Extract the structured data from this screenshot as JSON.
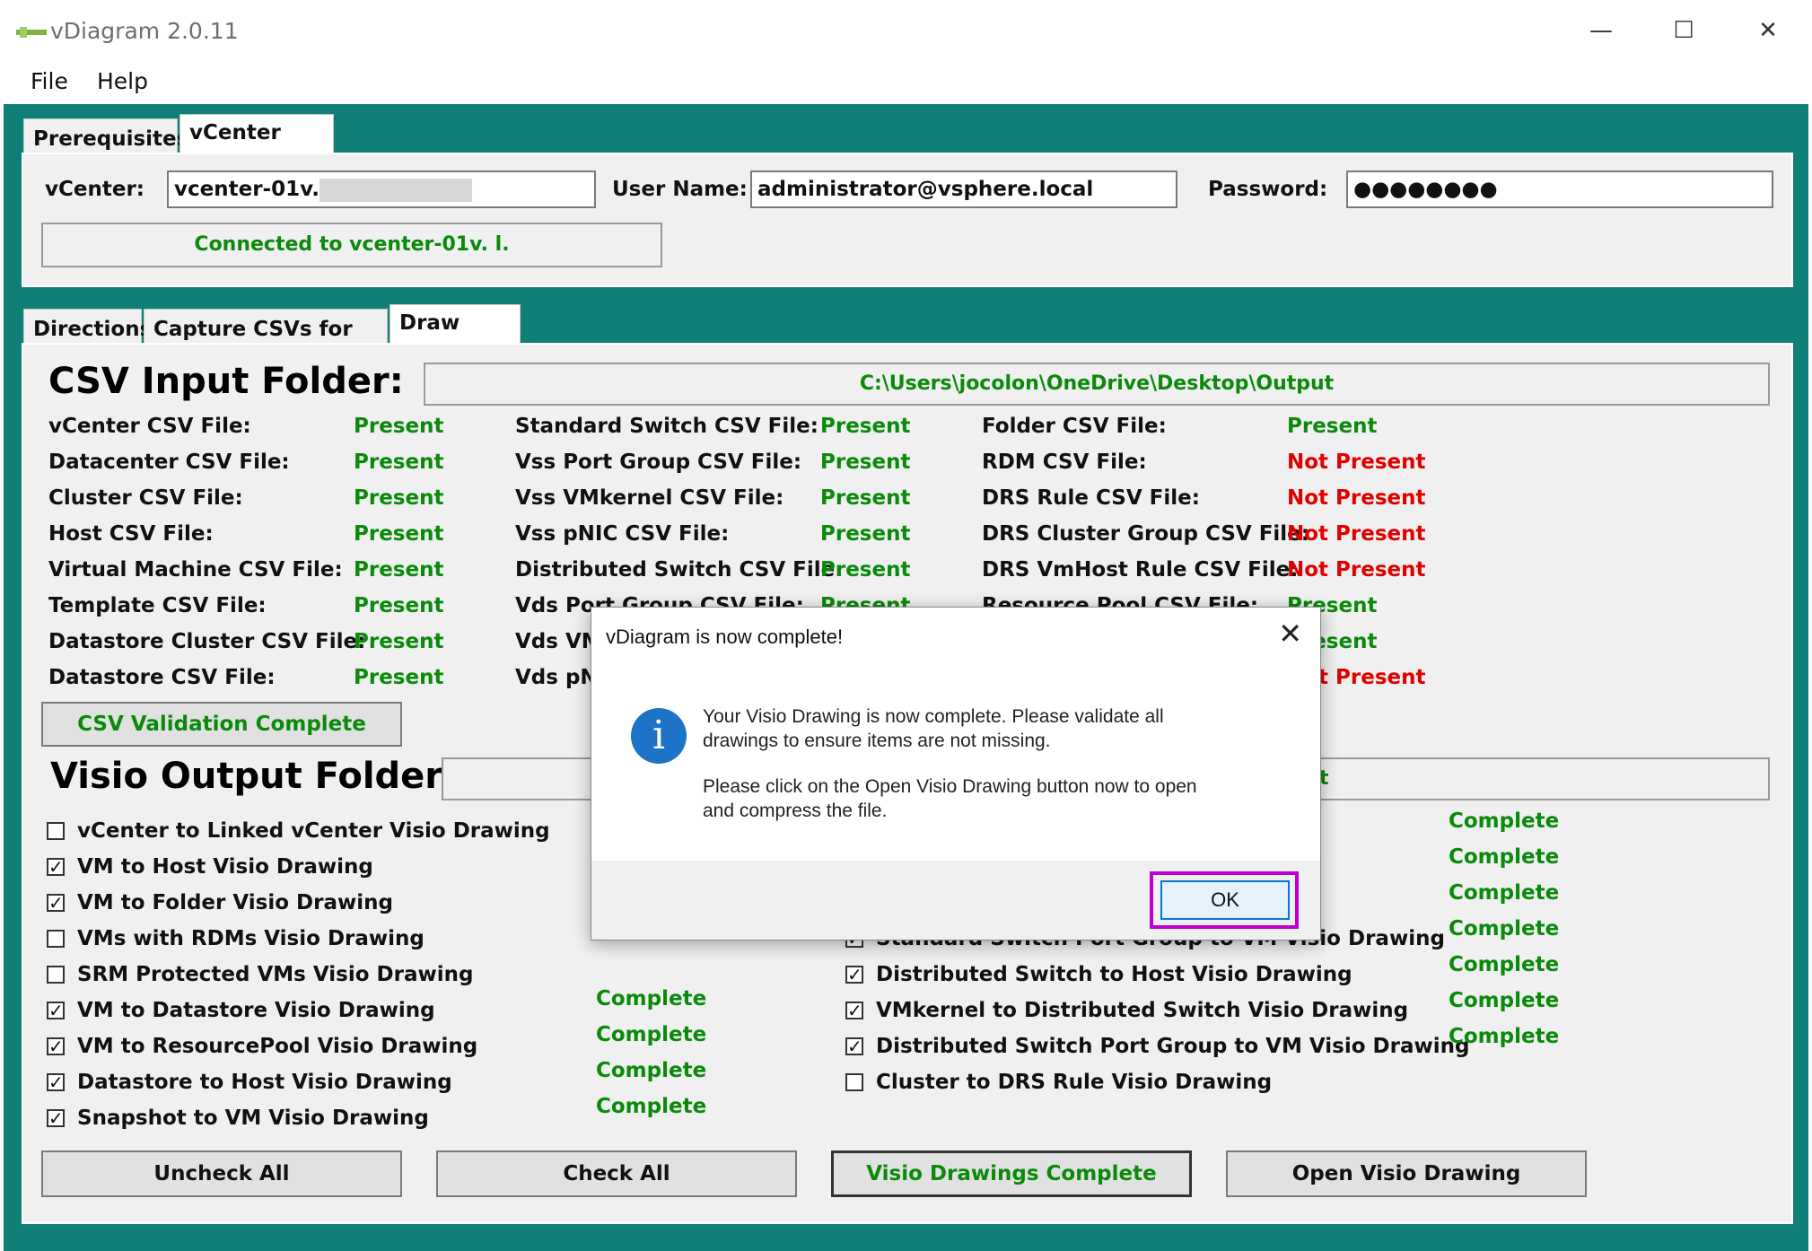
{
  "window": {
    "title": "vDiagram 2.0.11",
    "minimize": "—",
    "maximize": "☐",
    "close": "✕"
  },
  "menu": {
    "file": "File",
    "help": "Help"
  },
  "top_tabs": {
    "prerequisites": "Prerequisites",
    "vcenter_info": "vCenter Info"
  },
  "vcenter": {
    "vcenter_label": "vCenter:",
    "vcenter_value": "vcenter-01v.",
    "username_label": "User Name:",
    "username_value": "administrator@vsphere.local",
    "password_label": "Password:",
    "password_value": "●●●●●●●●",
    "connection_status": "Connected to vcenter-01v.                   l."
  },
  "lower_tabs": {
    "directions": "Directions",
    "capture": "Capture CSVs for Visio",
    "draw": "Draw Visio"
  },
  "csv_input": {
    "heading": "CSV Input Folder:",
    "path": "C:\\Users\\jocolon\\OneDrive\\Desktop\\Output",
    "col1": [
      {
        "label": "vCenter CSV File:",
        "status": "Present"
      },
      {
        "label": "Datacenter CSV File:",
        "status": "Present"
      },
      {
        "label": "Cluster CSV File:",
        "status": "Present"
      },
      {
        "label": "Host CSV File:",
        "status": "Present"
      },
      {
        "label": "Virtual Machine CSV File:",
        "status": "Present"
      },
      {
        "label": "Template CSV File:",
        "status": "Present"
      },
      {
        "label": "Datastore Cluster CSV File:",
        "status": "Present"
      },
      {
        "label": "Datastore CSV File:",
        "status": "Present"
      }
    ],
    "col2": [
      {
        "label": "Standard Switch CSV File:",
        "status": "Present"
      },
      {
        "label": "Vss Port Group CSV File:",
        "status": "Present"
      },
      {
        "label": "Vss VMkernel CSV File:",
        "status": "Present"
      },
      {
        "label": "Vss pNIC CSV File:",
        "status": "Present"
      },
      {
        "label": "Distributed Switch CSV File:",
        "status": "Present"
      },
      {
        "label": "Vds Port Group CSV File:",
        "status": "Present"
      },
      {
        "label": "Vds VMkernel CSV File:",
        "status": ""
      },
      {
        "label": "Vds pNIC CSV File:",
        "status": ""
      }
    ],
    "col3": [
      {
        "label": "Folder CSV File:",
        "status": "Present"
      },
      {
        "label": "RDM CSV File:",
        "status": "Not Present"
      },
      {
        "label": "DRS Rule CSV File:",
        "status": "Not Present"
      },
      {
        "label": "DRS Cluster Group CSV File:",
        "status": "Not Present"
      },
      {
        "label": "DRS VmHost Rule CSV File:",
        "status": "Not Present"
      },
      {
        "label": "Resource Pool CSV File:",
        "status": "Present"
      },
      {
        "label": "",
        "status": "Present"
      },
      {
        "label": "",
        "status": "Not Present"
      }
    ],
    "validation_button": "CSV Validation Complete"
  },
  "visio_output": {
    "heading": "Visio Output Folder:",
    "path_tail": "t",
    "left_items": [
      {
        "label": "vCenter to Linked vCenter Visio Drawing",
        "checked": false,
        "status": ""
      },
      {
        "label": "VM to Host Visio Drawing",
        "checked": true,
        "status": ""
      },
      {
        "label": "VM to Folder Visio Drawing",
        "checked": true,
        "status": ""
      },
      {
        "label": "VMs with RDMs Visio Drawing",
        "checked": false,
        "status": ""
      },
      {
        "label": "SRM Protected VMs Visio Drawing",
        "checked": false,
        "status": ""
      },
      {
        "label": "VM to Datastore Visio Drawing",
        "checked": true,
        "status": "Complete"
      },
      {
        "label": "VM to ResourcePool Visio Drawing",
        "checked": true,
        "status": "Complete"
      },
      {
        "label": "Datastore to Host Visio Drawing",
        "checked": true,
        "status": "Complete"
      },
      {
        "label": "Snapshot to VM Visio Drawing",
        "checked": true,
        "status": "Complete"
      }
    ],
    "right_items": [
      {
        "label": "",
        "checked": true,
        "status": "Complete"
      },
      {
        "label": "",
        "checked": true,
        "status": "Complete"
      },
      {
        "label": "",
        "checked": true,
        "status": "Complete"
      },
      {
        "label": "Standard Switch Port Group to VM Visio Drawing",
        "checked": true,
        "status": "Complete"
      },
      {
        "label": "Distributed Switch to Host Visio Drawing",
        "checked": true,
        "status": "Complete"
      },
      {
        "label": "VMkernel to Distributed Switch Visio Drawing",
        "checked": true,
        "status": "Complete"
      },
      {
        "label": "Distributed Switch Port Group to VM Visio Drawing",
        "checked": true,
        "status": "Complete"
      },
      {
        "label": "Cluster to DRS Rule Visio Drawing",
        "checked": false,
        "status": ""
      }
    ]
  },
  "buttons": {
    "uncheck_all": "Uncheck All",
    "check_all": "Check All",
    "drawings_complete": "Visio Drawings Complete",
    "open_visio": "Open Visio Drawing"
  },
  "dialog": {
    "title": "vDiagram is now complete!",
    "close": "✕",
    "icon": "i",
    "message1_line1": "Your Visio Drawing is now complete. Please validate all",
    "message1_line2": "drawings to ensure items are not missing.",
    "message2_line1": "Please click on the Open Visio Drawing button now to open",
    "message2_line2": "and compress the file.",
    "ok": "OK"
  },
  "colors": {
    "teal": "#0e8078",
    "present": "#0a8a0a",
    "not_present": "#e00000",
    "highlight": "#c000d0"
  }
}
